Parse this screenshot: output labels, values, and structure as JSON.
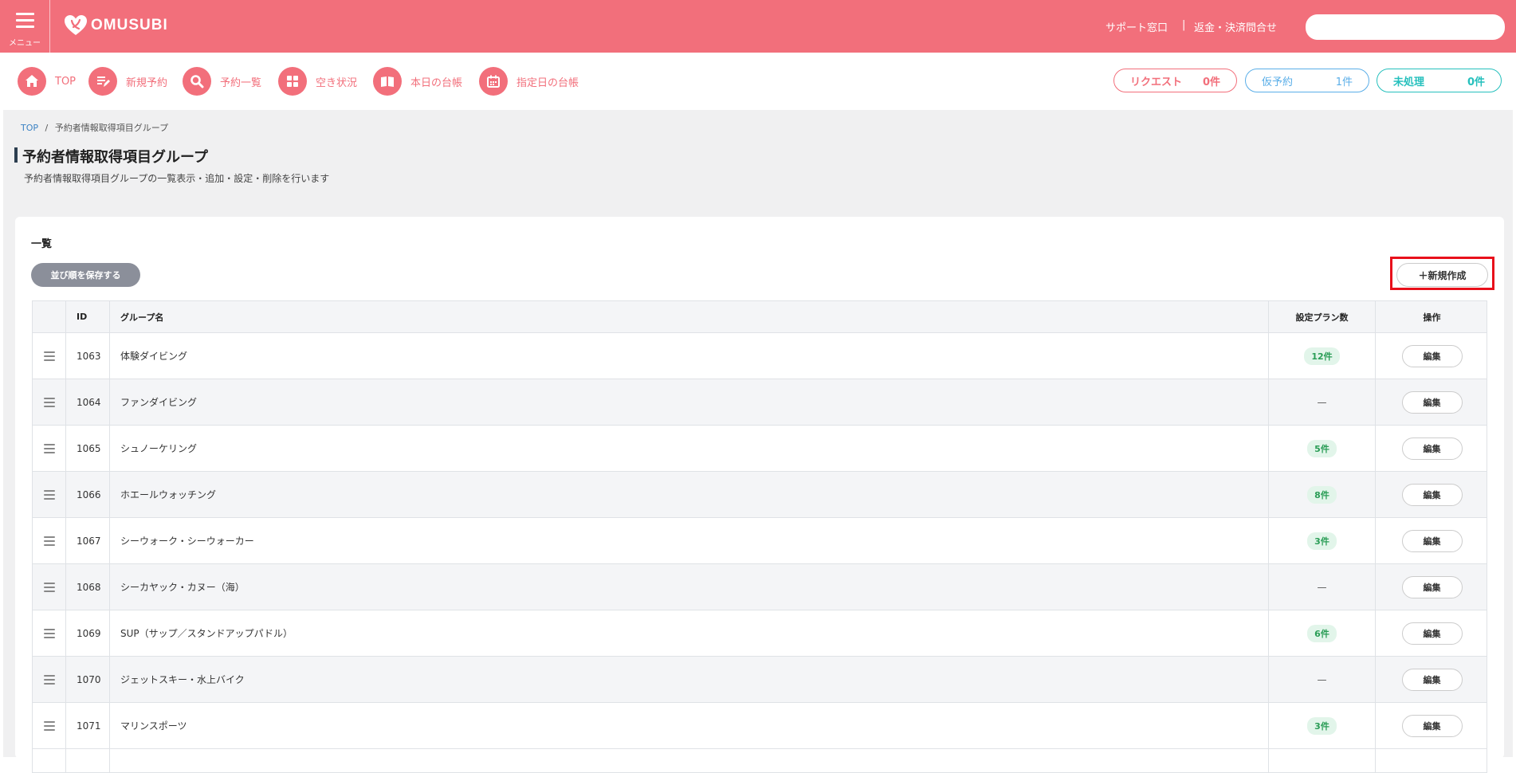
{
  "header": {
    "menu_label": "メニュー",
    "logo_text": "OMUSUBI",
    "support_link": "サポート窓口",
    "separator": "|",
    "refund_link": "返金・決済問合せ",
    "search_placeholder": ""
  },
  "nav": {
    "items": [
      {
        "label": "TOP",
        "icon": "home-icon"
      },
      {
        "label": "新規予約",
        "icon": "new-reservation-icon"
      },
      {
        "label": "予約一覧",
        "icon": "search-icon"
      },
      {
        "label": "空き状況",
        "icon": "grid-icon"
      },
      {
        "label": "本日の台帳",
        "icon": "book-icon"
      },
      {
        "label": "指定日の台帳",
        "icon": "calendar-icon"
      }
    ],
    "counters": [
      {
        "label": "リクエスト",
        "count": "0件",
        "color": "#f26f7b"
      },
      {
        "label": "仮予約",
        "count": "1件",
        "color": "#5aaee8"
      },
      {
        "label": "未処理",
        "count": "0件",
        "color": "#26c0bd"
      }
    ]
  },
  "breadcrumb": {
    "home": "TOP",
    "sep": "/",
    "current": "予約者情報取得項目グループ"
  },
  "page": {
    "title": "予約者情報取得項目グループ",
    "subtitle": "予約者情報取得項目グループの一覧表示・追加・設定・削除を行います"
  },
  "list": {
    "title": "一覧",
    "save_order_label": "並び順を保存する",
    "new_label": "＋新規作成",
    "columns": {
      "id": "ID",
      "name": "グループ名",
      "plans": "設定プラン数",
      "ops": "操作"
    },
    "edit_label": "編集",
    "rows": [
      {
        "id": "1063",
        "name": "体験ダイビング",
        "plans": "12件"
      },
      {
        "id": "1064",
        "name": "ファンダイビング",
        "plans": "—"
      },
      {
        "id": "1065",
        "name": "シュノーケリング",
        "plans": "5件"
      },
      {
        "id": "1066",
        "name": "ホエールウォッチング",
        "plans": "8件"
      },
      {
        "id": "1067",
        "name": "シーウォーク・シーウォーカー",
        "plans": "3件"
      },
      {
        "id": "1068",
        "name": "シーカヤック・カヌー（海）",
        "plans": "—"
      },
      {
        "id": "1069",
        "name": "SUP（サップ／スタンドアップパドル）",
        "plans": "6件"
      },
      {
        "id": "1070",
        "name": "ジェットスキー・水上バイク",
        "plans": "—"
      },
      {
        "id": "1071",
        "name": "マリンスポーツ",
        "plans": "3件"
      }
    ]
  },
  "colors": {
    "brand": "#f26f7b",
    "badge_green": "#2a9d56",
    "highlight": "#e8101b"
  }
}
